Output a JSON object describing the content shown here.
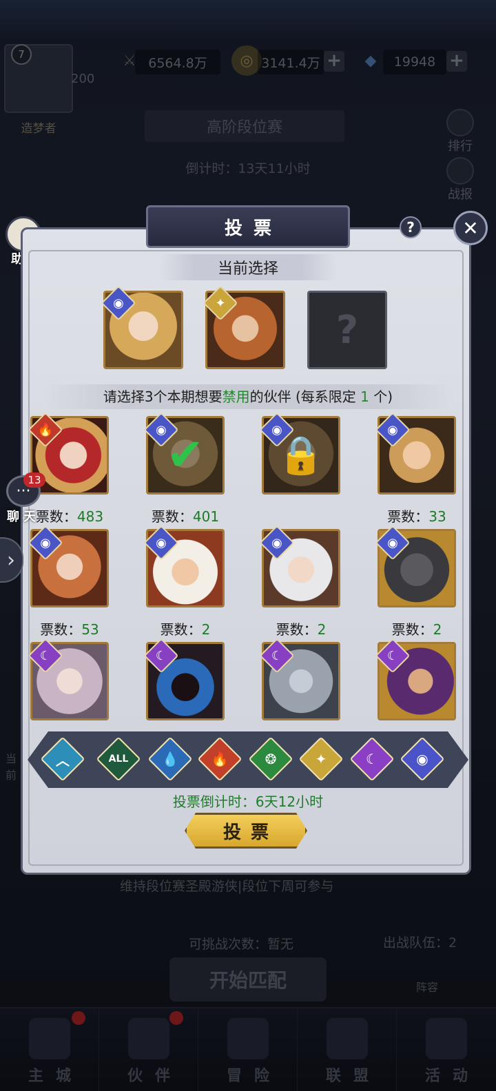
{
  "top_bar": {
    "level": "7",
    "power": "200",
    "rank_title": "造梦者",
    "combat_power": "6564.8万",
    "gold": "3141.4万",
    "diamonds": "19948"
  },
  "season": {
    "title": "高阶段位赛",
    "countdown": "倒计时：13天11小时"
  },
  "side_right": {
    "rank_label": "排行",
    "battle_report_label": "战报"
  },
  "side_left": {
    "assistant_label": "助手",
    "chat_label": "聊天",
    "chat_badge": "13"
  },
  "dialog": {
    "title": "投票",
    "help_symbol": "?",
    "current_selection_label": "当前选择",
    "instruction_prefix": "请选择3个本期想要",
    "instruction_highlight": "禁用",
    "instruction_suffix": "的伙伴 (每系限定",
    "instruction_limit": "1",
    "instruction_end": "个)",
    "vote_countdown": "投票倒计时：6天12小时",
    "vote_button": "投票"
  },
  "selected": [
    {
      "element": "cosmic",
      "desc": "blonde-woman"
    },
    {
      "element": "light",
      "desc": "warrior-man"
    },
    {
      "element": "",
      "desc": "unknown"
    }
  ],
  "heroes": [
    {
      "element": "fire",
      "votes_label": "票数：",
      "votes": "483",
      "state": "normal"
    },
    {
      "element": "cosmic",
      "votes_label": "票数：",
      "votes": "401",
      "state": "checked"
    },
    {
      "element": "cosmic",
      "votes_label": "",
      "votes": "",
      "state": "locked"
    },
    {
      "element": "cosmic",
      "votes_label": "票数：",
      "votes": "33",
      "state": "normal"
    },
    {
      "element": "cosmic",
      "votes_label": "票数：",
      "votes": "53",
      "state": "normal"
    },
    {
      "element": "cosmic",
      "votes_label": "票数：",
      "votes": "2",
      "state": "normal"
    },
    {
      "element": "cosmic",
      "votes_label": "票数：",
      "votes": "2",
      "state": "normal"
    },
    {
      "element": "cosmic",
      "votes_label": "票数：",
      "votes": "2",
      "state": "normal"
    },
    {
      "element": "moon",
      "votes_label": "",
      "votes": "",
      "state": "normal"
    },
    {
      "element": "moon",
      "votes_label": "",
      "votes": "",
      "state": "normal"
    },
    {
      "element": "moon",
      "votes_label": "",
      "votes": "",
      "state": "normal"
    },
    {
      "element": "moon",
      "votes_label": "",
      "votes": "",
      "state": "normal"
    }
  ],
  "filters": [
    {
      "name": "wind",
      "label": "︿",
      "color": "#2d8fb8"
    },
    {
      "name": "all",
      "label": "ALL",
      "color": "#1f5a3c"
    },
    {
      "name": "water",
      "label": "💧",
      "color": "#2b6bb5"
    },
    {
      "name": "fire",
      "label": "🔥",
      "color": "#c2402a"
    },
    {
      "name": "nature",
      "label": "❂",
      "color": "#2b8a3e"
    },
    {
      "name": "light",
      "label": "✦",
      "color": "#c9a63a"
    },
    {
      "name": "moon",
      "label": "☾",
      "color": "#8a3fc4"
    },
    {
      "name": "cosmic",
      "label": "◉",
      "color": "#4a53c8"
    }
  ],
  "background": {
    "maintain_text": "维持段位赛圣殿游侠|段位下周可参与",
    "challenge_count": "可挑战次数：暂无",
    "team_count": "出战队伍：2",
    "match_button": "开始匹配",
    "lineup_label": "阵容",
    "left_side_label": "当前"
  },
  "nav": [
    "主城",
    "伙伴",
    "冒险",
    "联盟",
    "活动"
  ],
  "colors": {
    "fire": "#c0392b",
    "cosmic": "#4b56c6",
    "light": "#c9a53c",
    "moon": "#8840c2",
    "frame": "#a37a3a",
    "vote_green": "#1d7a26"
  }
}
